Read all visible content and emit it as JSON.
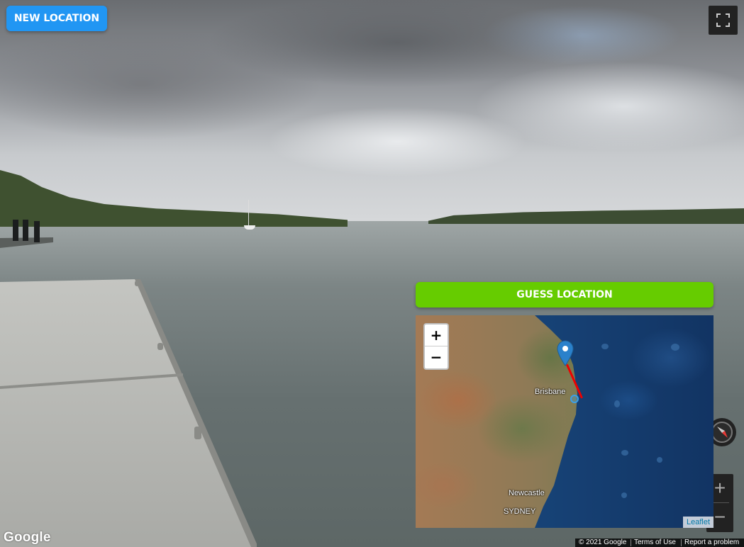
{
  "buttons": {
    "new_location": "NEW LOCATION",
    "guess_location": "GUESS LOCATION"
  },
  "icons": {
    "fullscreen": "fullscreen-icon",
    "compass": "compass-icon",
    "map_pin": "map-pin-icon"
  },
  "streetview_zoom": {
    "in": "+",
    "out": "−"
  },
  "minimap": {
    "zoom_in": "+",
    "zoom_out": "−",
    "labels": [
      "Brisbane",
      "Newcastle",
      "SYDNEY"
    ],
    "attribution": "Leaflet"
  },
  "branding": {
    "logo": "Google"
  },
  "footer": {
    "copyright": "© 2021 Google",
    "terms": "Terms of Use",
    "report": "Report a problem"
  },
  "colors": {
    "new_location_button": "#2196f3",
    "guess_button": "#66cc00",
    "guess_line": "#ee0000",
    "marker": "#2a81cb"
  }
}
